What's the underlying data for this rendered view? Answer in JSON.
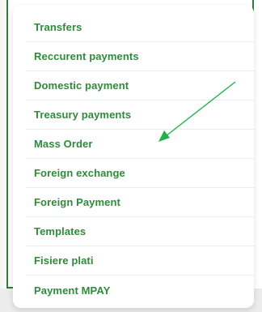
{
  "menu": {
    "items": [
      {
        "label": "Transfers"
      },
      {
        "label": "Reccurent payments"
      },
      {
        "label": "Domestic payment"
      },
      {
        "label": "Treasury payments"
      },
      {
        "label": "Mass Order"
      },
      {
        "label": "Foreign exchange"
      },
      {
        "label": "Foreign Payment"
      },
      {
        "label": "Templates"
      },
      {
        "label": "Fisiere plati"
      },
      {
        "label": "Payment MPAY"
      }
    ]
  },
  "colors": {
    "accent": "#2e8b3a",
    "frame": "#2e7d32",
    "arrow": "#22b14c"
  },
  "annotation": {
    "icon": "arrow-icon",
    "points_to": "Mass Order"
  }
}
